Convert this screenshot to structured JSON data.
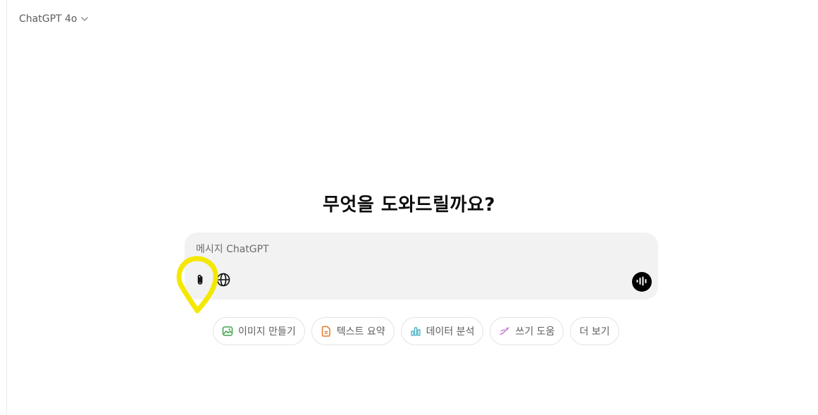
{
  "header": {
    "model_label": "ChatGPT 4o"
  },
  "main": {
    "headline": "무엇을 도와드릴까요?"
  },
  "composer": {
    "placeholder": "메시지 ChatGPT",
    "value": ""
  },
  "chips": [
    {
      "label": "이미지 만들기",
      "icon": "image-icon",
      "color": "#3fa34d"
    },
    {
      "label": "텍스트 요약",
      "icon": "document-icon",
      "color": "#e07a2c"
    },
    {
      "label": "데이터 분석",
      "icon": "bar-chart-icon",
      "color": "#4db3c4"
    },
    {
      "label": "쓰기 도움",
      "icon": "pen-icon",
      "color": "#c27ccf"
    },
    {
      "label": "더 보기",
      "icon": "",
      "color": ""
    }
  ],
  "annotation": {
    "highlight_color": "#f5e800"
  }
}
